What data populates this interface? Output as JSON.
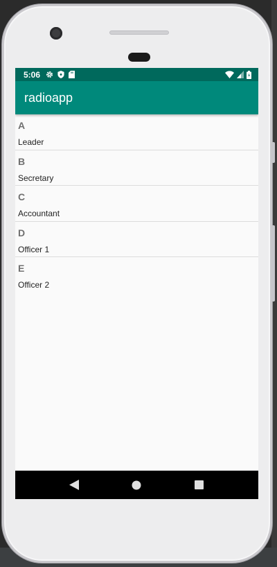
{
  "status_bar": {
    "time": "5:06",
    "icons_left": [
      "gear-icon",
      "shield-icon",
      "sd-card-icon"
    ],
    "icons_right": [
      "wifi-icon",
      "signal-icon",
      "battery-icon"
    ]
  },
  "app_bar": {
    "title": "radioapp"
  },
  "list": {
    "items": [
      {
        "letter": "A",
        "name": "Leader"
      },
      {
        "letter": "B",
        "name": "Secretary"
      },
      {
        "letter": "C",
        "name": "Accountant"
      },
      {
        "letter": "D",
        "name": "Officer 1"
      },
      {
        "letter": "E",
        "name": "Officer 2"
      }
    ]
  },
  "nav_bar": {
    "buttons": [
      "back-icon",
      "home-icon",
      "recents-icon"
    ]
  },
  "colors": {
    "status_bar": "#00695c",
    "app_bar": "#00897b",
    "screen_background": "#fafafa",
    "nav_bar": "#000000"
  }
}
